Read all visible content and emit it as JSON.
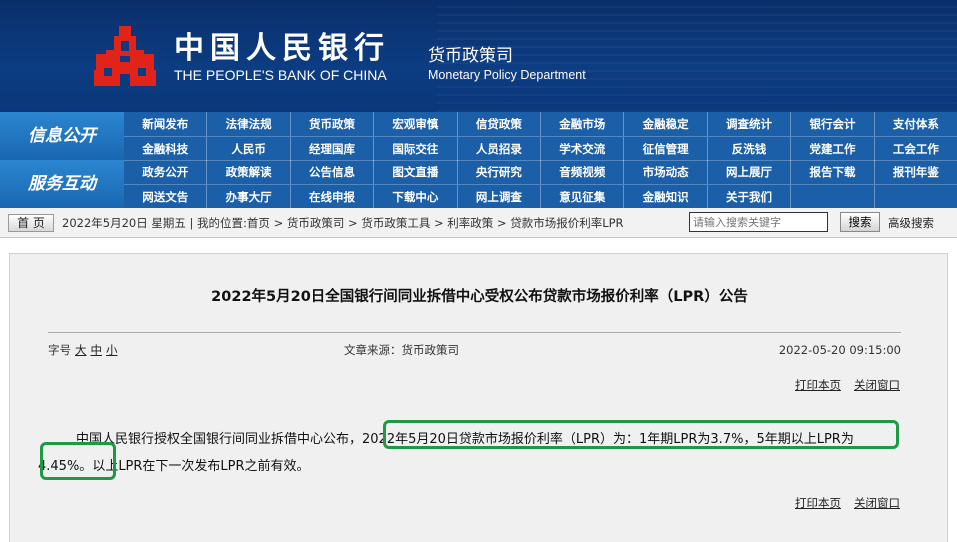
{
  "header": {
    "logo_cn": "中国人民银行",
    "logo_en": "THE PEOPLE'S BANK OF CHINA",
    "dept_cn": "货币政策司",
    "dept_en": "Monetary Policy Department",
    "logo_color": "#e2231a"
  },
  "nav": {
    "group1": "信息公开",
    "group2": "服务互动",
    "rows": [
      [
        "新闻发布",
        "法律法规",
        "货币政策",
        "宏观审慎",
        "信贷政策",
        "金融市场",
        "金融稳定",
        "调查统计",
        "银行会计",
        "支付体系"
      ],
      [
        "金融科技",
        "人民币",
        "经理国库",
        "国际交往",
        "人员招录",
        "学术交流",
        "征信管理",
        "反洗钱",
        "党建工作",
        "工会工作"
      ],
      [
        "政务公开",
        "政策解读",
        "公告信息",
        "图文直播",
        "央行研究",
        "音频视频",
        "市场动态",
        "网上展厅",
        "报告下载",
        "报刊年鉴"
      ],
      [
        "网送文告",
        "办事大厅",
        "在线申报",
        "下载中心",
        "网上调查",
        "意见征集",
        "金融知识",
        "关于我们",
        "",
        ""
      ]
    ]
  },
  "crumbbar": {
    "home": "首 页",
    "path": "2022年5月20日 星期五 | 我的位置:首页 > 货币政策司 > 货币政策工具 > 利率政策 > 贷款市场报价利率LPR",
    "search_placeholder": "请输入搜索关键字",
    "search_button": "搜索",
    "advanced": "高级搜索"
  },
  "article": {
    "title": "2022年5月20日全国银行间同业拆借中心受权公布贷款市场报价利率（LPR）公告",
    "fontsize_label": "字号",
    "fontsize_large": "大",
    "fontsize_medium": "中",
    "fontsize_small": "小",
    "source": "文章来源：货币政策司",
    "date": "2022-05-20 09:15:00",
    "print": "打印本页",
    "close": "关闭窗口",
    "body_before": "中国人民银行授权全国银行间同业拆借中心公布，",
    "body_highlight": "2022年5月20日贷款市场报价利率（LPR）为：1年期LPR为3.7%，5年期以上LPR为4.45%。",
    "body_after": "以上LPR在下一次发布LPR之前有效。",
    "highlight_color": "#1e9a44"
  }
}
